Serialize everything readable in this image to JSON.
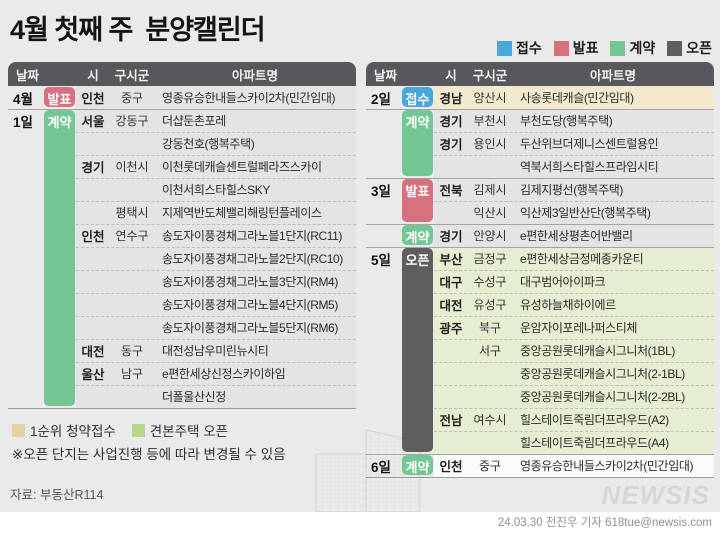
{
  "title": "4월 첫째 주  분양캘린더",
  "legend": {
    "items": [
      {
        "label": "접수",
        "color": "accept_blue"
      },
      {
        "label": "발표",
        "color": "announce_pink"
      },
      {
        "label": "계약",
        "color": "contract_green"
      },
      {
        "label": "오픈",
        "color": "open_dark"
      }
    ]
  },
  "columns": [
    "날짜",
    "시",
    "구시군",
    "아파트명"
  ],
  "left_table": {
    "rows": [
      {
        "date": "4월",
        "si": "인천",
        "gu": "중구",
        "name": "영종유승한내들스카이2차(민간임대)",
        "sep": "",
        "bg": ""
      },
      {
        "date": "1일",
        "si": "서울",
        "gu": "강동구",
        "name": "더샵둔촌포레",
        "sep": "solid",
        "bg": ""
      },
      {
        "date": "",
        "si": "",
        "gu": "",
        "name": "강동천호(행복주택)",
        "sep": "dashed",
        "bg": ""
      },
      {
        "date": "",
        "si": "경기",
        "gu": "이천시",
        "name": "이천롯데캐슬센트럴페라즈스카이",
        "sep": "dashed",
        "bg": ""
      },
      {
        "date": "",
        "si": "",
        "gu": "",
        "name": "이천서희스타힐스SKY",
        "sep": "dashed",
        "bg": ""
      },
      {
        "date": "",
        "si": "",
        "gu": "평택시",
        "name": "지제역반도체밸리해링턴플레이스",
        "sep": "dashed",
        "bg": ""
      },
      {
        "date": "",
        "si": "인천",
        "gu": "연수구",
        "name": "송도자이풍경채그라노블1단지(RC11)",
        "sep": "dashed",
        "bg": ""
      },
      {
        "date": "",
        "si": "",
        "gu": "",
        "name": "송도자이풍경채그라노블2단지(RC10)",
        "sep": "dashed",
        "bg": ""
      },
      {
        "date": "",
        "si": "",
        "gu": "",
        "name": "송도자이풍경채그라노블3단지(RM4)",
        "sep": "dashed",
        "bg": ""
      },
      {
        "date": "",
        "si": "",
        "gu": "",
        "name": "송도자이풍경채그라노블4단지(RM5)",
        "sep": "dashed",
        "bg": ""
      },
      {
        "date": "",
        "si": "",
        "gu": "",
        "name": "송도자이풍경채그라노블5단지(RM6)",
        "sep": "dashed",
        "bg": ""
      },
      {
        "date": "",
        "si": "대전",
        "gu": "동구",
        "name": "대전성남우미린뉴시티",
        "sep": "dashed",
        "bg": ""
      },
      {
        "date": "",
        "si": "울산",
        "gu": "남구",
        "name": "e편한세상신정스카이하임",
        "sep": "dashed",
        "bg": ""
      },
      {
        "date": "",
        "si": "",
        "gu": "",
        "name": "더폴울산신정",
        "sep": "dashed",
        "bg": ""
      }
    ],
    "bands": [
      {
        "label": "발표",
        "color": "announce_pink",
        "start": 0,
        "span": 1
      },
      {
        "label": "계약",
        "color": "contract_green",
        "start": 1,
        "span": 13
      }
    ]
  },
  "right_table": {
    "rows": [
      {
        "date": "2일",
        "si": "경남",
        "gu": "양산시",
        "name": "사송롯데캐슬(민간임대)",
        "sep": "",
        "bg": "row_tan"
      },
      {
        "date": "",
        "si": "경기",
        "gu": "부천시",
        "name": "부천도당(행복주택)",
        "sep": "solid",
        "bg": ""
      },
      {
        "date": "",
        "si": "경기",
        "gu": "용인시",
        "name": "두산위브더제니스센트럴용인",
        "sep": "dashed",
        "bg": ""
      },
      {
        "date": "",
        "si": "",
        "gu": "",
        "name": "역북서희스타힐스프라임시티",
        "sep": "dashed",
        "bg": ""
      },
      {
        "date": "3일",
        "si": "전북",
        "gu": "김제시",
        "name": "김제지평선(행복주택)",
        "sep": "solid",
        "bg": ""
      },
      {
        "date": "",
        "si": "",
        "gu": "익산시",
        "name": "익산제3일반산단(행복주택)",
        "sep": "dashed",
        "bg": ""
      },
      {
        "date": "",
        "si": "경기",
        "gu": "안양시",
        "name": "e편한세상평촌어반밸리",
        "sep": "solid",
        "bg": ""
      },
      {
        "date": "5일",
        "si": "부산",
        "gu": "금정구",
        "name": "e편한세상금정메종카운티",
        "sep": "solid",
        "bg": "row_green"
      },
      {
        "date": "",
        "si": "대구",
        "gu": "수성구",
        "name": "대구범어아이파크",
        "sep": "dashed",
        "bg": "row_green"
      },
      {
        "date": "",
        "si": "대전",
        "gu": "유성구",
        "name": "유성하늘채하이에르",
        "sep": "dashed",
        "bg": "row_green"
      },
      {
        "date": "",
        "si": "광주",
        "gu": "북구",
        "name": "운암자이포레나퍼스티체",
        "sep": "dashed",
        "bg": "row_green"
      },
      {
        "date": "",
        "si": "",
        "gu": "서구",
        "name": "중앙공원롯데캐슬시그니처(1BL)",
        "sep": "dashed",
        "bg": "row_green"
      },
      {
        "date": "",
        "si": "",
        "gu": "",
        "name": "중앙공원롯데캐슬시그니처(2-1BL)",
        "sep": "dashed",
        "bg": "row_green"
      },
      {
        "date": "",
        "si": "",
        "gu": "",
        "name": "중앙공원롯데캐슬시그니처(2-2BL)",
        "sep": "dashed",
        "bg": "row_green"
      },
      {
        "date": "",
        "si": "전남",
        "gu": "여수시",
        "name": "힐스테이트죽림더프라우드(A2)",
        "sep": "dashed",
        "bg": "row_green"
      },
      {
        "date": "",
        "si": "",
        "gu": "",
        "name": "힐스테이트죽림더프라우드(A4)",
        "sep": "dashed",
        "bg": "row_green"
      },
      {
        "date": "6일",
        "si": "인천",
        "gu": "중구",
        "name": "영종유승한내들스카이2차(민간임대)",
        "sep": "solid",
        "bg": "row_white"
      }
    ],
    "bands": [
      {
        "label": "접수",
        "color": "accept_blue",
        "start": 0,
        "span": 1
      },
      {
        "label": "계약",
        "color": "contract_green",
        "start": 1,
        "span": 3
      },
      {
        "label": "발표",
        "color": "announce_pink",
        "start": 4,
        "span": 2
      },
      {
        "label": "계약",
        "color": "contract_green",
        "start": 6,
        "span": 1
      },
      {
        "label": "오픈",
        "color": "open_dark",
        "start": 7,
        "span": 9
      },
      {
        "label": "계약",
        "color": "contract_green",
        "start": 16,
        "span": 1
      }
    ]
  },
  "footer": {
    "legend": [
      {
        "label": "1순위 청약접수",
        "color": "legend_tan"
      },
      {
        "label": "견본주택 오픈",
        "color": "legend_green"
      }
    ],
    "note": "※오픈 단지는 사업진행 등에 따라 변경될 수 있음",
    "source": "자료: 부동산R114",
    "logo": "NEWSIS",
    "credit": "24.03.30 전진우 기자 618tue@newsis.com"
  },
  "colors": {
    "accept_blue": "#4aa7d9",
    "announce_pink": "#d7707f",
    "contract_green": "#74c694",
    "open_dark": "#5e5e5e",
    "row_tan": "#f3e9cd",
    "row_green": "#e6eed2",
    "row_white": "#fafafa",
    "legend_tan": "#e4d2a2",
    "legend_green": "#b7d788"
  }
}
